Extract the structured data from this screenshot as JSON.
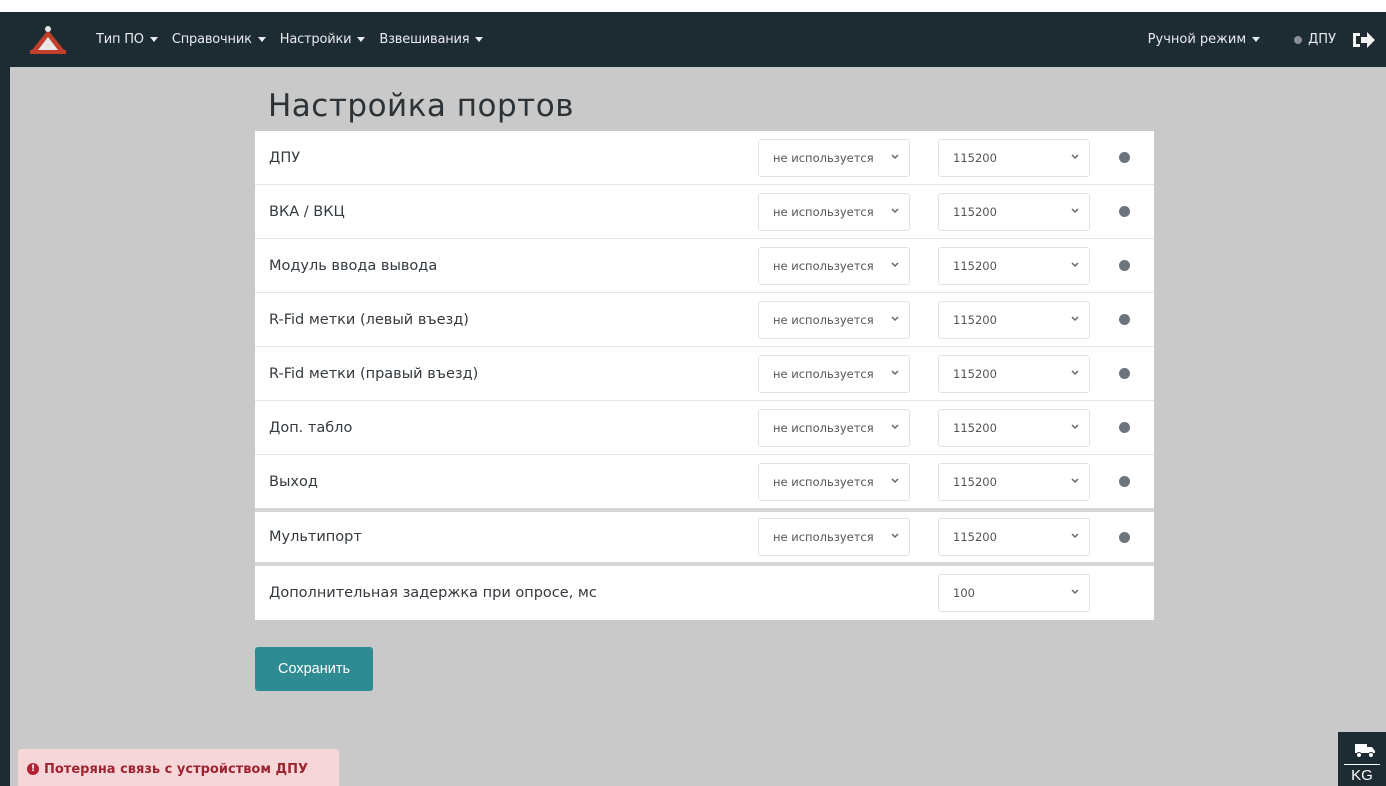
{
  "navbar": {
    "menu": [
      "Тип ПО",
      "Справочник",
      "Настройки",
      "Взвешивания"
    ],
    "mode_label": "Ручной режим",
    "device_status_label": "ДПУ",
    "logo_icon": "scale-logo-icon",
    "logout_icon": "logout-icon"
  },
  "page": {
    "title": "Настройка портов"
  },
  "ports": [
    {
      "label": "ДПУ",
      "port": "не используется",
      "baud": "115200"
    },
    {
      "label": "ВКА / ВКЦ",
      "port": "не используется",
      "baud": "115200"
    },
    {
      "label": "Модуль ввода вывода",
      "port": "не используется",
      "baud": "115200"
    },
    {
      "label": "R-Fid метки (левый въезд)",
      "port": "не используется",
      "baud": "115200"
    },
    {
      "label": "R-Fid метки (правый въезд)",
      "port": "не используется",
      "baud": "115200"
    },
    {
      "label": "Доп. табло",
      "port": "не используется",
      "baud": "115200"
    },
    {
      "label": "Выход",
      "port": "не используется",
      "baud": "115200"
    },
    {
      "label": "Мультипорт",
      "port": "не используется",
      "baud": "115200"
    }
  ],
  "delay": {
    "label": "Дополнительная задержка при опросе, мс",
    "value": "100"
  },
  "actions": {
    "save_label": "Сохранить"
  },
  "alert": {
    "icon": "exclamation-icon",
    "text": "Потеряна связь с устройством ДПУ"
  },
  "unit": {
    "icon": "truck-icon",
    "label": "KG"
  },
  "colors": {
    "navbar_bg": "#1d2b33",
    "accent": "#2e8b91",
    "alert_bg": "#f6d6d8",
    "alert_text": "#9c2530",
    "status_dot": "#6c757d"
  }
}
